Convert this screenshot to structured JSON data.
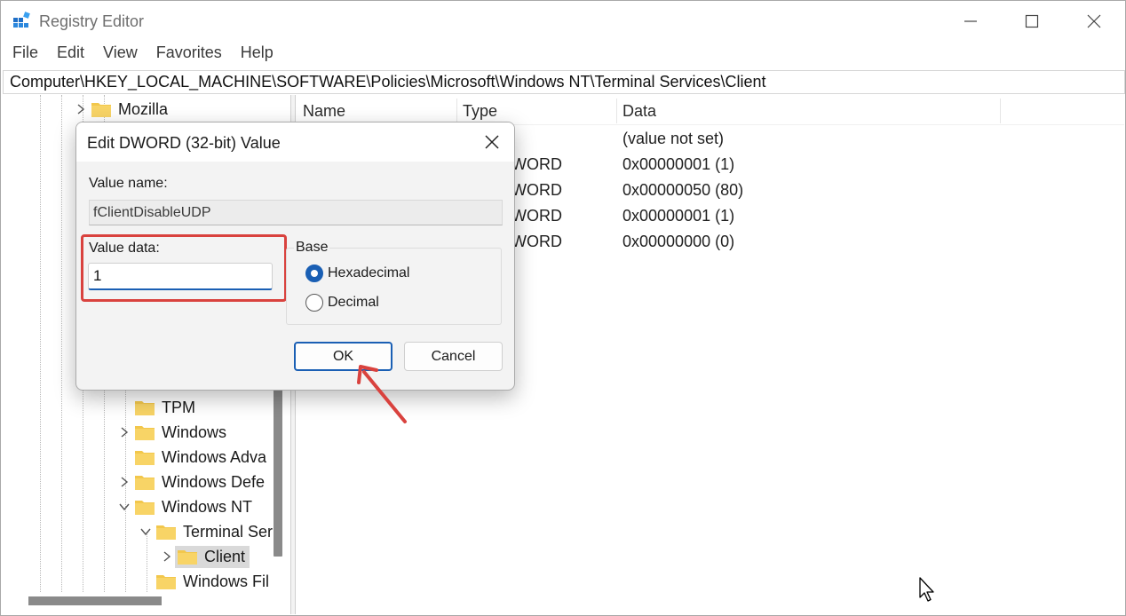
{
  "window": {
    "title": "Registry Editor",
    "controls": [
      "minimize-icon",
      "maximize-icon",
      "close-icon"
    ]
  },
  "menu": [
    "File",
    "Edit",
    "View",
    "Favorites",
    "Help"
  ],
  "address": "Computer\\HKEY_LOCAL_MACHINE\\SOFTWARE\\Policies\\Microsoft\\Windows NT\\Terminal Services\\Client",
  "tree": {
    "items": [
      {
        "label": "Mozilla",
        "expander": "collapsed"
      },
      {
        "label": "TPM",
        "expander": "none"
      },
      {
        "label": "Windows",
        "expander": "collapsed"
      },
      {
        "label": "Windows Adva",
        "expander": "none"
      },
      {
        "label": "Windows Defe",
        "expander": "collapsed"
      },
      {
        "label": "Windows NT",
        "expander": "expanded"
      },
      {
        "label": "Terminal Ser",
        "expander": "expanded"
      },
      {
        "label": "Client",
        "expander": "collapsed",
        "selected": true
      },
      {
        "label": "Windows Fil",
        "expander": "none"
      }
    ]
  },
  "list": {
    "columns": [
      "Name",
      "Type",
      "Data"
    ],
    "rows": [
      {
        "type": "",
        "data": "(value not set)"
      },
      {
        "type": "WORD",
        "data": "0x00000001 (1)"
      },
      {
        "type": "WORD",
        "data": "0x00000050 (80)"
      },
      {
        "type": "WORD",
        "data": "0x00000001 (1)"
      },
      {
        "type": "WORD",
        "data": "0x00000000 (0)"
      }
    ]
  },
  "dialog": {
    "title": "Edit DWORD (32-bit) Value",
    "value_name_label": "Value name:",
    "value_name": "fClientDisableUDP",
    "value_data_label": "Value data:",
    "value_data": "1",
    "base_label": "Base",
    "base_options": [
      {
        "label": "Hexadecimal",
        "checked": true
      },
      {
        "label": "Decimal",
        "checked": false
      }
    ],
    "ok_label": "OK",
    "cancel_label": "Cancel"
  },
  "colors": {
    "accent": "#1a5fb4",
    "highlight": "#d9423e",
    "folder": "#f2c74c"
  }
}
